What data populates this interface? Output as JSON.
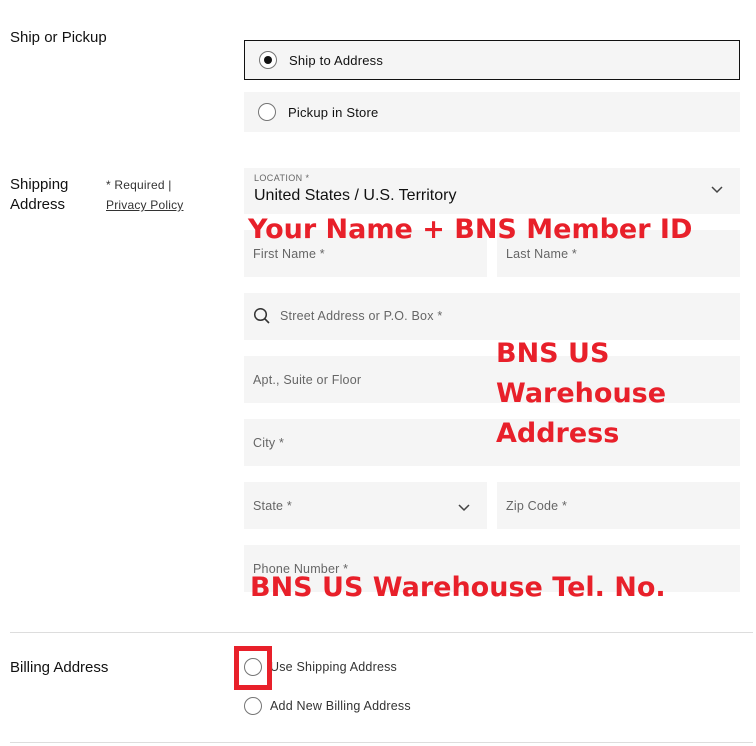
{
  "ship_or_pickup": {
    "label": "Ship or Pickup",
    "options": [
      {
        "label": "Ship to Address",
        "selected": true
      },
      {
        "label": "Pickup in Store",
        "selected": false
      }
    ]
  },
  "shipping_address": {
    "label": "Shipping Address",
    "required_note": "* Required |",
    "privacy_link": "Privacy Policy",
    "location": {
      "label": "LOCATION *",
      "value": "United States / U.S. Territory"
    },
    "first_name_placeholder": "First Name *",
    "last_name_placeholder": "Last Name *",
    "street_placeholder": "Street Address or P.O. Box *",
    "apt_placeholder": "Apt., Suite or Floor",
    "city_placeholder": "City *",
    "state_placeholder": "State *",
    "zip_placeholder": "Zip Code *",
    "phone_placeholder": "Phone Number *"
  },
  "annotations": {
    "name_id": "Your Name + BNS Member ID",
    "warehouse_line1": "BNS US",
    "warehouse_line2": "Warehouse",
    "warehouse_line3": "Address",
    "warehouse_tel": "BNS US Warehouse Tel. No.",
    "highlight_color": "#e8202a"
  },
  "billing_address": {
    "label": "Billing Address",
    "options": [
      {
        "label": "Use Shipping Address",
        "selected": false
      },
      {
        "label": "Add New Billing Address",
        "selected": false
      }
    ]
  }
}
